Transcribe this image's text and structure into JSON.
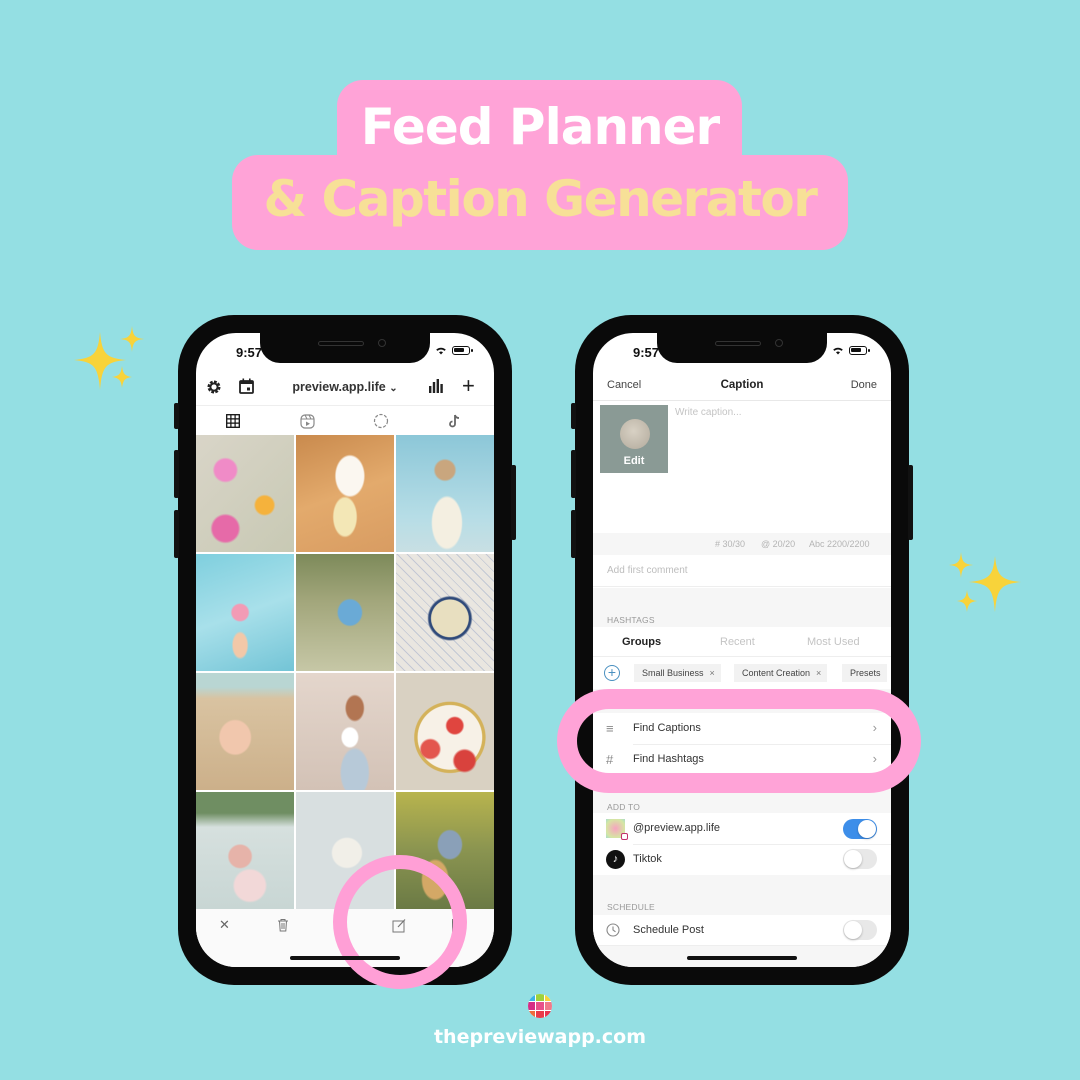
{
  "title": {
    "line1": "Feed Planner",
    "line2": "& Caption Generator"
  },
  "colors": {
    "background": "#94dfe3",
    "title_pill": "#ffa3d7",
    "title_line1": "#ffffff",
    "title_line2": "#f7e097",
    "highlight": "#ffa3d7",
    "toggle_on": "#3d8ee9"
  },
  "left_phone": {
    "status_time": "9:57",
    "header": {
      "settings_icon": "gear-icon",
      "calendar_icon": "calendar-icon",
      "account": "preview.app.life",
      "account_chevron": "⌄",
      "stats_icon": "bar-chart-icon",
      "add_icon": "+"
    },
    "tabs": [
      {
        "name": "grid",
        "icon": "grid-icon",
        "active": true
      },
      {
        "name": "reels",
        "icon": "reels-icon",
        "active": false
      },
      {
        "name": "stories",
        "icon": "stories-icon",
        "active": false
      },
      {
        "name": "tiktok",
        "icon": "tiktok-icon",
        "active": false
      }
    ],
    "grid_photos": [
      {
        "subject": "pressed flowers in ice"
      },
      {
        "subject": "corgi with melon"
      },
      {
        "subject": "woman in straw hat by sea"
      },
      {
        "subject": "hand holding pink flowers against sky"
      },
      {
        "subject": "person lying in daisy field"
      },
      {
        "subject": "blueberry dessert on plate"
      },
      {
        "subject": "hand holding seashells on beach"
      },
      {
        "subject": "woman with white tulips"
      },
      {
        "subject": "strawberry desserts on gold plate"
      },
      {
        "subject": "picnic blanket with treats"
      },
      {
        "subject": "full moon in pale sky"
      },
      {
        "subject": "woman hugging golden retriever"
      }
    ],
    "bottom_toolbar": [
      {
        "icon": "close-icon",
        "glyph": "✕"
      },
      {
        "icon": "trash-icon",
        "glyph": "🗑"
      },
      {
        "icon": "circle-icon",
        "glyph": "◍"
      },
      {
        "icon": "edit-caption-icon",
        "glyph": "✎"
      },
      {
        "icon": "crop-icon",
        "glyph": "["
      }
    ]
  },
  "right_phone": {
    "status_time": "9:57",
    "nav": {
      "cancel": "Cancel",
      "title": "Caption",
      "done": "Done"
    },
    "thumbnail_edit": "Edit",
    "caption_placeholder": "Write caption...",
    "counts": {
      "hashtags": "# 30/30",
      "mentions": "@ 20/20",
      "characters": "Abc 2200/2200"
    },
    "first_comment_placeholder": "Add first comment",
    "hashtags": {
      "section_label": "HASHTAGS",
      "tabs": [
        {
          "label": "Groups",
          "active": true
        },
        {
          "label": "Recent",
          "active": false
        },
        {
          "label": "Most Used",
          "active": false
        }
      ],
      "chips": [
        {
          "label": "Small Business",
          "remove": "×"
        },
        {
          "label": "Content Creation",
          "remove": "×"
        },
        {
          "label": "Presets",
          "remove": ""
        }
      ]
    },
    "tools": [
      {
        "label": "Find Captions",
        "icon": "lines-icon",
        "glyph": "≡",
        "chevron": "›"
      },
      {
        "label": "Find Hashtags",
        "icon": "hashtag-icon",
        "glyph": "#",
        "chevron": "›"
      }
    ],
    "add_to": {
      "section_label": "ADD TO",
      "accounts": [
        {
          "label": "@preview.app.life",
          "enabled": true
        },
        {
          "label": "Tiktok",
          "enabled": false
        }
      ]
    },
    "schedule": {
      "section_label": "SCHEDULE",
      "label": "Schedule Post",
      "icon": "clock-icon",
      "enabled": false
    }
  },
  "footer": {
    "website": "thepreviewapp.com"
  }
}
